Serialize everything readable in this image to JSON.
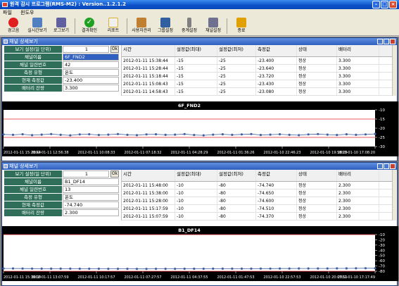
{
  "window": {
    "title": "원격 감시 프로그램(RMS-M2) : Version..1.2.1.2"
  },
  "menu": [
    {
      "label": "파일"
    },
    {
      "label": "윈도우"
    }
  ],
  "toolbar": [
    {
      "label": "경고음",
      "icon": "alarm-icon",
      "color": "#e02020"
    },
    {
      "label": "실시간보기",
      "icon": "realtime-view-icon",
      "color": "#5080c0"
    },
    {
      "label": "로그보기",
      "icon": "log-view-icon",
      "color": "#6060a0"
    },
    {
      "label": "결과확인",
      "icon": "check-icon",
      "color": "#20a020"
    },
    {
      "label": "리포트",
      "icon": "report-icon",
      "color": "#e0b030"
    },
    {
      "label": "사용자관리",
      "icon": "user-admin-icon",
      "color": "#c08030"
    },
    {
      "label": "그룹설정",
      "icon": "group-settings-icon",
      "color": "#3060a0"
    },
    {
      "label": "중계설정",
      "icon": "relay-settings-icon",
      "color": "#808080"
    },
    {
      "label": "채널설정",
      "icon": "channel-settings-icon",
      "color": "#707090"
    },
    {
      "label": "종료",
      "icon": "exit-icon",
      "color": "#e0a000"
    }
  ],
  "panels": [
    {
      "title": "채널 상세보기",
      "form": {
        "view_setting_label": "보기 설정(일 단위)",
        "view_setting_value": "1",
        "ok_label": "Ok",
        "channel_name_label": "채널이름",
        "channel_name_value": "6F_FND2",
        "serial_label": "채널 일련번호",
        "serial_value": "42",
        "type_label": "측정 유형",
        "type_value": "온도",
        "current_label": "현재 측정값",
        "current_value": "-23.400",
        "battery_label": "배터리 잔량",
        "battery_value": "3.300"
      },
      "table": {
        "headers": [
          "시간",
          "설정값(최대)",
          "설정값(최저)",
          "측정값",
          "상태",
          "배터리"
        ],
        "rows": [
          [
            "2012-01-11 15:38:44",
            "-15",
            "-25",
            "-23.400",
            "정상",
            "3.300"
          ],
          [
            "2012-01-11 15:28:44",
            "-15",
            "-25",
            "-23.640",
            "정상",
            "3.300"
          ],
          [
            "2012-01-11 15:18:44",
            "-15",
            "-25",
            "-23.720",
            "정상",
            "3.300"
          ],
          [
            "2012-01-11 15:08:43",
            "-15",
            "-25",
            "-23.430",
            "정상",
            "3.300"
          ],
          [
            "2012-01-11 14:58:43",
            "-15",
            "-25",
            "-23.080",
            "정상",
            "3.300"
          ]
        ]
      },
      "chart_data": {
        "type": "line",
        "title": "6F_FND2",
        "ylim": [
          -30,
          -10
        ],
        "yticks": [
          -10,
          -15,
          -20,
          -25,
          -30
        ],
        "xticks": [
          "2012-01-11 15:28:44",
          "2012-01-11 12:56:38",
          "2012-01-11 10:08:33",
          "2012-01-11 07:18:32",
          "2012-01-11 04:28:29",
          "2012-01-11 01:36:26",
          "2012-01-10 22:46:23",
          "2012-01-10 19:58:29",
          "2012-01-10 17:08:20"
        ],
        "series": [
          {
            "color": "#e02020",
            "values": [
              -15,
              -15
            ]
          },
          {
            "color": "#e02020",
            "values": [
              -25,
              -25
            ]
          },
          {
            "color": "#4060a0",
            "values": [
              -23.4,
              -23.6,
              -23.3,
              -23.8,
              -23.5,
              -23.2,
              -23.6,
              -23.9,
              -23.4,
              -23.3,
              -23.7,
              -23.5,
              -23.2,
              -23.6,
              -23.8,
              -23.4,
              -23.3,
              -23.6,
              -23.5,
              -23.2,
              -23.7,
              -23.9,
              -23.5,
              -23.3,
              -23.6,
              -23.4,
              -23.2,
              -23.7,
              -23.5,
              -23.3,
              -23.6,
              -23.8,
              -23.4,
              -23.2,
              -23.5,
              -23.7,
              -23.3,
              -23.6,
              -23.4,
              -23.1
            ]
          }
        ]
      }
    },
    {
      "title": "채널 상세보기",
      "form": {
        "view_setting_label": "보기 설정(일 단위)",
        "view_setting_value": "1",
        "ok_label": "Ok",
        "channel_name_label": "채널이름",
        "channel_name_value": "B1_DF14",
        "serial_label": "채널 일련번호",
        "serial_value": "13",
        "type_label": "측정 유형",
        "type_value": "온도",
        "current_label": "현재 측정값",
        "current_value": "-74.740",
        "battery_label": "배터리 잔량",
        "battery_value": "2.300"
      },
      "table": {
        "headers": [
          "시간",
          "설정값(최대)",
          "설정값(최저)",
          "측정값",
          "상태",
          "배터리"
        ],
        "rows": [
          [
            "2012-01-11 15:48:00",
            "-10",
            "-80",
            "-74.740",
            "정상",
            "2.300"
          ],
          [
            "2012-01-11 15:38:00",
            "-10",
            "-80",
            "-74.650",
            "정상",
            "2.300"
          ],
          [
            "2012-01-11 15:28:00",
            "-10",
            "-80",
            "-74.600",
            "정상",
            "2.300"
          ],
          [
            "2012-01-11 15:17:59",
            "-10",
            "-80",
            "-74.510",
            "정상",
            "2.300"
          ],
          [
            "2012-01-11 15:07:59",
            "-10",
            "-80",
            "-74.370",
            "정상",
            "2.300"
          ]
        ]
      },
      "chart_data": {
        "type": "line",
        "title": "B1_DF14",
        "ylim": [
          -80,
          -10
        ],
        "yticks": [
          -10,
          -20,
          -30,
          -40,
          -50,
          -60,
          -70,
          -80
        ],
        "xticks": [
          "2012-01-11 15:38:00",
          "2012-01-11 13:07:59",
          "2012-01-11 10:17:57",
          "2012-01-11 07:27:57",
          "2012-01-11 04:37:55",
          "2012-01-11 01:47:53",
          "2012-01-10 22:57:53",
          "2012-01-10 20:07:51",
          "2012-01-10 17:17:49"
        ],
        "series": [
          {
            "color": "#e02020",
            "values": [
              -10,
              -10
            ]
          },
          {
            "color": "#e02020",
            "values": [
              -80,
              -80
            ]
          },
          {
            "color": "#4060a0",
            "values": [
              -74.7,
              -74.8,
              -74.9,
              -75.0,
              -75.1,
              -75.1,
              -75.2,
              -75.2,
              -75.3,
              -75.3,
              -75.3,
              -75.4,
              -75.4,
              -75.4,
              -75.5,
              -75.5,
              -75.4,
              -75.4,
              -75.4,
              -75.3,
              -75.3,
              -75.3,
              -75.2,
              -75.2,
              -75.2,
              -75.1,
              -75.1,
              -75.0,
              -75.0,
              -74.9,
              -74.9,
              -74.8,
              -74.8,
              -74.7,
              -74.7,
              -74.6,
              -74.6,
              -74.5,
              -74.4,
              -74.3
            ]
          }
        ]
      }
    }
  ]
}
